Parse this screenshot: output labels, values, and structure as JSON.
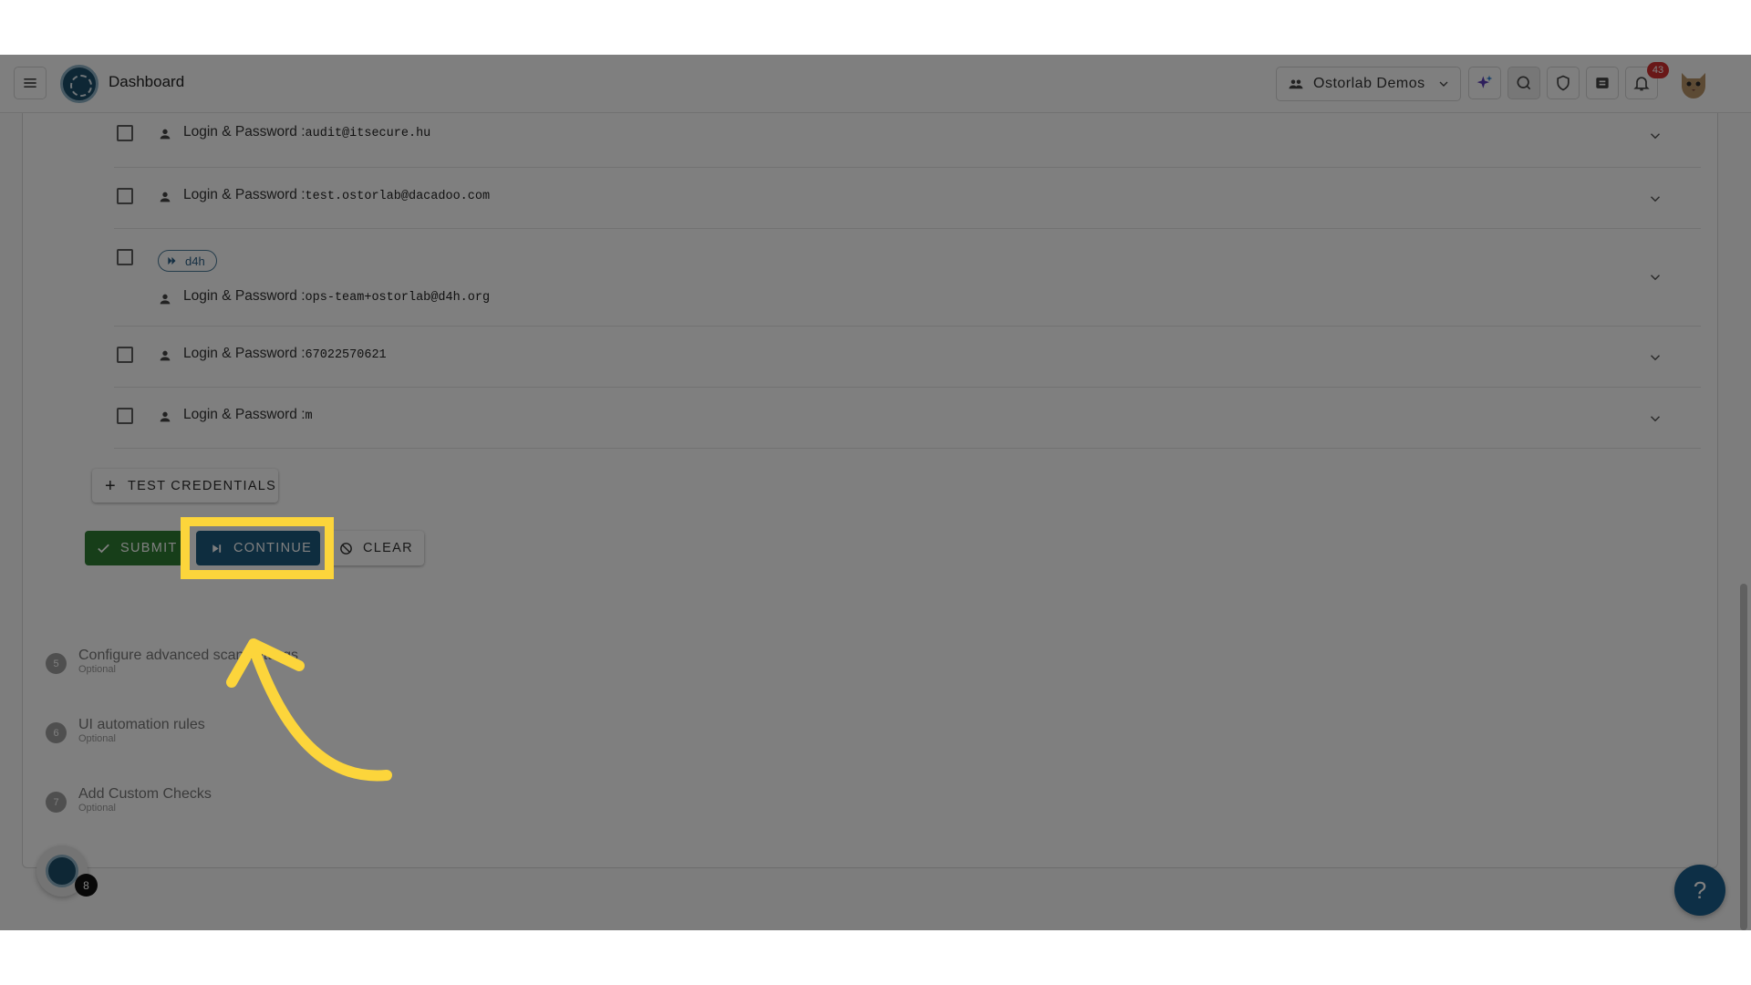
{
  "appbar": {
    "title": "Dashboard",
    "organization": "Ostorlab Demos",
    "notification_count": "43",
    "icons": [
      "menu-icon",
      "ostorlab-logo",
      "team-icon",
      "ai-sparkle-icon",
      "scan-icon",
      "shield-icon",
      "ticket-icon",
      "bell-icon",
      "cat-avatar"
    ]
  },
  "credentials": {
    "items": [
      {
        "label": "Login & Password :",
        "value": "audit@itsecure.hu"
      },
      {
        "label": "Login & Password :",
        "value": "test.ostorlab@dacadoo.com"
      },
      {
        "tag": "d4h",
        "label": "Login & Password :",
        "value": "ops-team+ostorlab@d4h.org"
      },
      {
        "label": "Login & Password :",
        "value": "67022570621"
      },
      {
        "label": "Login & Password :",
        "value": "m"
      }
    ],
    "add_button": "TEST CREDENTIALS"
  },
  "actions": {
    "submit": "SUBMIT",
    "continue": "CONTINUE",
    "clear": "CLEAR"
  },
  "steps": [
    {
      "number": "5",
      "title": "Configure advanced scan settings",
      "subtitle": "Optional"
    },
    {
      "number": "6",
      "title": "UI automation rules",
      "subtitle": "Optional"
    },
    {
      "number": "7",
      "title": "Add Custom Checks",
      "subtitle": "Optional"
    }
  ],
  "widget": {
    "count": "8"
  },
  "help": {
    "label": "?"
  },
  "colors": {
    "highlight": "#fcd53b",
    "submit": "#2e7d32",
    "continue": "#1d5a7e",
    "help": "#1b5f8c",
    "badge": "#d32f2f"
  }
}
